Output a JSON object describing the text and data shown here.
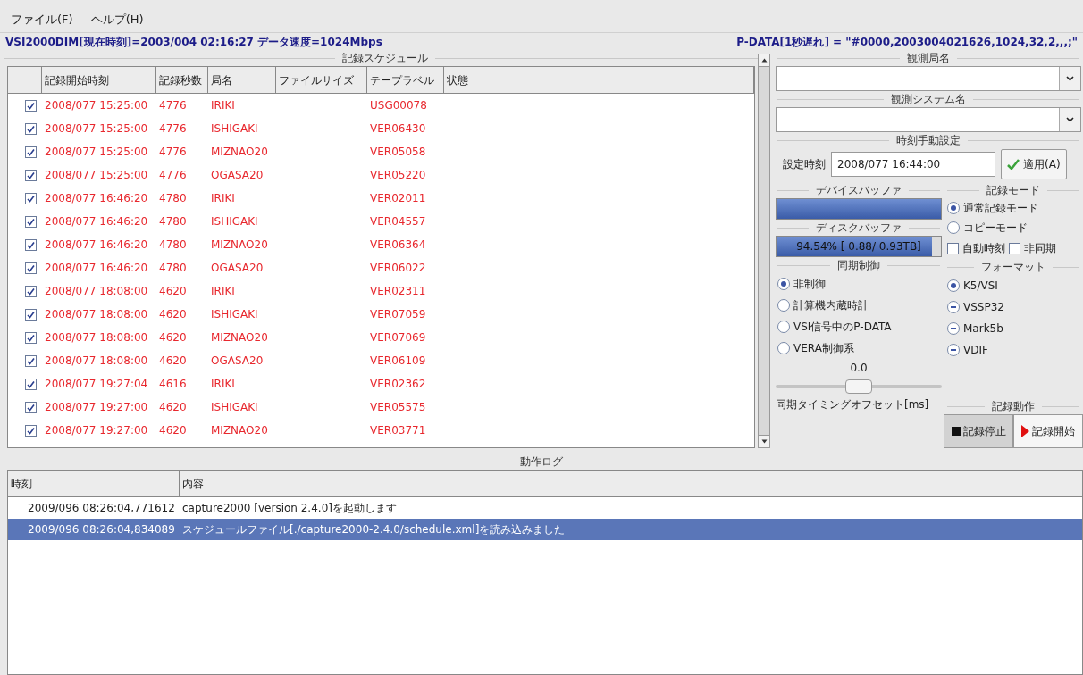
{
  "menu": [
    "ファイル(F)",
    "ヘルプ(H)"
  ],
  "status": {
    "left": "VSI2000DIM[現在時刻]=2003/004 02:16:27 データ速度=1024Mbps",
    "right": "P-DATA[1秒遅れ] = \"#0000,2003004021626,1024,32,2,,,;\""
  },
  "schedule": {
    "title": "記録スケジュール",
    "columns": [
      "記録開始時刻",
      "記録秒数",
      "局名",
      "ファイルサイズ",
      "テープラベル",
      "状態"
    ],
    "rows": [
      {
        "checked": true,
        "start": "2008/077 15:25:00",
        "seconds": "4776",
        "station": "IRIKI",
        "tape": "USG00078"
      },
      {
        "checked": true,
        "start": "2008/077 15:25:00",
        "seconds": "4776",
        "station": "ISHIGAKI",
        "tape": "VER06430"
      },
      {
        "checked": true,
        "start": "2008/077 15:25:00",
        "seconds": "4776",
        "station": "MIZNAO20",
        "tape": "VER05058"
      },
      {
        "checked": true,
        "start": "2008/077 15:25:00",
        "seconds": "4776",
        "station": "OGASA20",
        "tape": "VER05220"
      },
      {
        "checked": true,
        "start": "2008/077 16:46:20",
        "seconds": "4780",
        "station": "IRIKI",
        "tape": "VER02011"
      },
      {
        "checked": true,
        "start": "2008/077 16:46:20",
        "seconds": "4780",
        "station": "ISHIGAKI",
        "tape": "VER04557"
      },
      {
        "checked": true,
        "start": "2008/077 16:46:20",
        "seconds": "4780",
        "station": "MIZNAO20",
        "tape": "VER06364"
      },
      {
        "checked": true,
        "start": "2008/077 16:46:20",
        "seconds": "4780",
        "station": "OGASA20",
        "tape": "VER06022"
      },
      {
        "checked": true,
        "start": "2008/077 18:08:00",
        "seconds": "4620",
        "station": "IRIKI",
        "tape": "VER02311"
      },
      {
        "checked": true,
        "start": "2008/077 18:08:00",
        "seconds": "4620",
        "station": "ISHIGAKI",
        "tape": "VER07059"
      },
      {
        "checked": true,
        "start": "2008/077 18:08:00",
        "seconds": "4620",
        "station": "MIZNAO20",
        "tape": "VER07069"
      },
      {
        "checked": true,
        "start": "2008/077 18:08:00",
        "seconds": "4620",
        "station": "OGASA20",
        "tape": "VER06109"
      },
      {
        "checked": true,
        "start": "2008/077 19:27:04",
        "seconds": "4616",
        "station": "IRIKI",
        "tape": "VER02362"
      },
      {
        "checked": true,
        "start": "2008/077 19:27:00",
        "seconds": "4620",
        "station": "ISHIGAKI",
        "tape": "VER05575"
      },
      {
        "checked": true,
        "start": "2008/077 19:27:00",
        "seconds": "4620",
        "station": "MIZNAO20",
        "tape": "VER03771"
      }
    ]
  },
  "station": {
    "title": "観測局名"
  },
  "system": {
    "title": "観測システム名"
  },
  "manual_time": {
    "title": "時刻手動設定",
    "label": "設定時刻",
    "value": "2008/077 16:44:00",
    "button": "適用(A)"
  },
  "device_buffer": {
    "title": "デバイスバッファ",
    "level": 1
  },
  "disk_buffer": {
    "title": "ディスクバッファ",
    "level": 0.9454,
    "reading": "94.54% [ 0.88/ 0.93TB]"
  },
  "record_mode": {
    "title": "記録モード",
    "options": [
      {
        "label": "通常記録モード",
        "selected": true
      },
      {
        "label": "コピーモード",
        "selected": false
      }
    ],
    "checks": [
      {
        "label": "自動時刻",
        "checked": false
      },
      {
        "label": "非同期",
        "checked": false
      }
    ]
  },
  "sync": {
    "title": "同期制御",
    "options": [
      {
        "label": "非制御",
        "selected": true
      },
      {
        "label": "計算機内蔵時計",
        "selected": false
      },
      {
        "label": "VSI信号中のP-DATA",
        "selected": false
      },
      {
        "label": "VERA制御系",
        "selected": false
      }
    ],
    "offset_value": "0.0",
    "offset_slider": {
      "level": 0.5
    },
    "offset_label": "同期タイミングオフセット[ms]"
  },
  "format": {
    "title": "フォーマット",
    "options": [
      {
        "label": "K5/VSI",
        "selected": true,
        "disabled": false
      },
      {
        "label": "VSSP32",
        "selected": false,
        "disabled": true
      },
      {
        "label": "Mark5b",
        "selected": false,
        "disabled": true
      },
      {
        "label": "VDIF",
        "selected": false,
        "disabled": true
      }
    ]
  },
  "record_action": {
    "title": "記録動作",
    "buttons": [
      {
        "label": "記録停止",
        "kind": "stop",
        "pressed": true
      },
      {
        "label": "記録開始",
        "kind": "start",
        "pressed": false
      }
    ]
  },
  "log": {
    "title": "動作ログ",
    "columns": [
      "時刻",
      "内容"
    ],
    "rows": [
      {
        "time": "2009/096 08:26:04,771612",
        "text": "capture2000 [version 2.4.0]を起動します",
        "selected": false
      },
      {
        "time": "2009/096 08:26:04,834089",
        "text": "スケジュールファイル[./capture2000-2.4.0/schedule.xml]を読み込みました",
        "selected": true
      }
    ]
  }
}
